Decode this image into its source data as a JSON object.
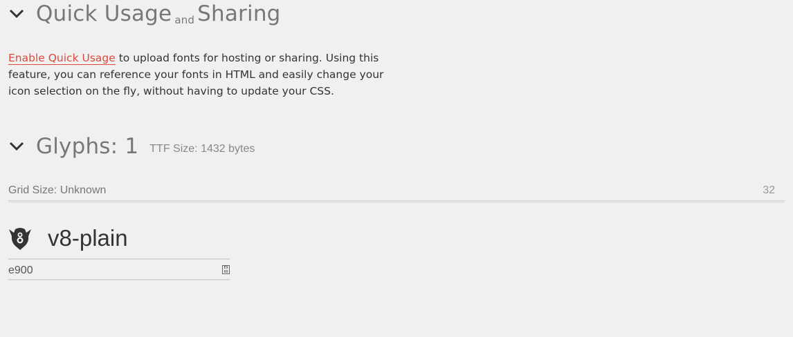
{
  "quick_usage": {
    "title_main": "Quick Usage",
    "title_and": "and",
    "title_sharing": "Sharing",
    "link_text": "Enable Quick Usage",
    "description_rest": " to upload fonts for hosting or sharing. Using this feature, you can reference your fonts in HTML and easily change your icon selection on the fly, without having to update your CSS.",
    "chevron_icon": "chevron-down-icon"
  },
  "glyphs": {
    "title": "Glyphs: 1",
    "ttf_size": "TTF Size: 1432 bytes",
    "chevron_icon": "chevron-down-icon"
  },
  "grid": {
    "label": "Grid Size: Unknown",
    "value": "32"
  },
  "glyph_list": [
    {
      "icon": "v8-logo-icon",
      "name": "v8-plain",
      "code": "e900",
      "code_icon": "unicode-icon"
    }
  ],
  "colors": {
    "accent": "#e0483a",
    "background": "#f0f0f0",
    "heading": "#777777"
  }
}
